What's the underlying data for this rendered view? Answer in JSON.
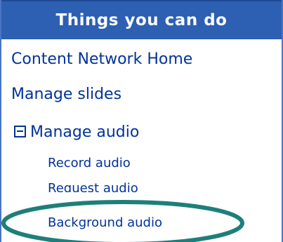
{
  "panel": {
    "title": "Things you can do",
    "links": [
      {
        "label": "Content Network Home"
      },
      {
        "label": "Manage slides"
      },
      {
        "label": "Manage audio"
      }
    ],
    "sub_links": [
      {
        "label": "Record audio"
      },
      {
        "label": "Request audio"
      },
      {
        "label": "Background audio"
      }
    ]
  },
  "icons": {
    "collapse": "collapse-square-minus-icon"
  },
  "colors": {
    "header_bg": "#2d5fb3",
    "link": "#003399",
    "highlight": "#1e7f7a"
  }
}
